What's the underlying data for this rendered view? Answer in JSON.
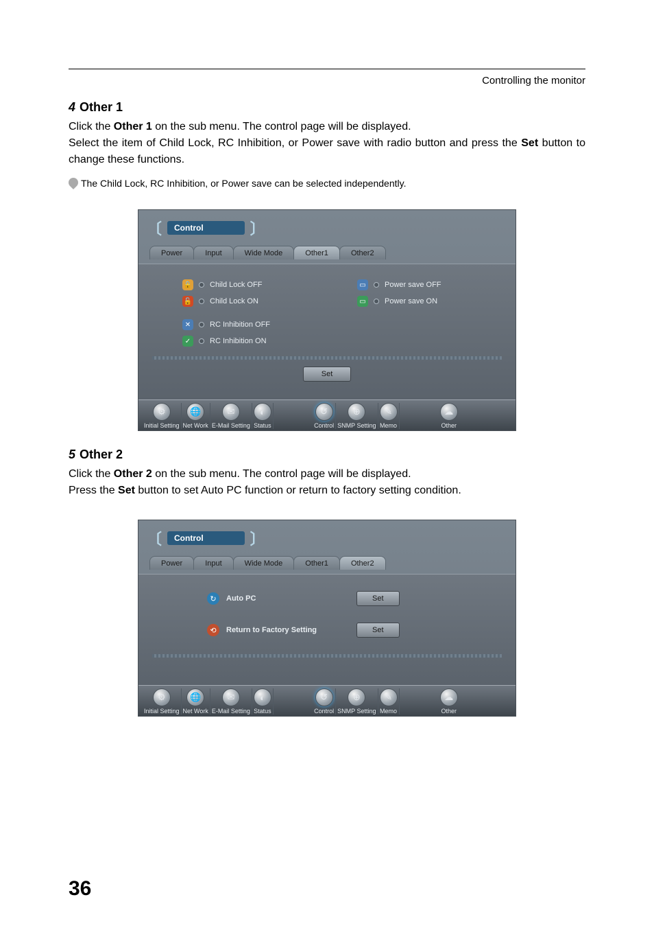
{
  "header": {
    "right": "Controlling the monitor"
  },
  "section1": {
    "num": "4",
    "title": "Other 1",
    "para": "Click the <b>Other 1</b> on the sub menu. The control page will be displayed.\nSelect the item of Child Lock, RC Inhibition, or Power save with radio button and press the <b>Set</b> button to change these functions.",
    "note": "The Child Lock, RC Inhibition, or Power save can be selected independently."
  },
  "panel1": {
    "bracket_title": "Control",
    "tabs": [
      "Power",
      "Input",
      "Wide Mode",
      "Other1",
      "Other2"
    ],
    "active_tab": 3,
    "child_lock_off": "Child Lock OFF",
    "child_lock_on": "Child Lock ON",
    "rc_off": "RC Inhibition OFF",
    "rc_on": "RC Inhibition ON",
    "ps_off": "Power save OFF",
    "ps_on": "Power save ON",
    "set_label": "Set",
    "footer": [
      "Initial Setting",
      "Net Work",
      "E-Mail Setting",
      "Status",
      "Control",
      "SNMP Setting",
      "Memo",
      "Other"
    ],
    "footer_active": 4
  },
  "section2": {
    "num": "5",
    "title": "Other 2",
    "para": "Click the <b>Other 2</b> on the sub menu. The control page will be displayed.\nPress the <b>Set</b> button to set Auto PC function or return to factory setting condition."
  },
  "panel2": {
    "bracket_title": "Control",
    "tabs": [
      "Power",
      "Input",
      "Wide Mode",
      "Other1",
      "Other2"
    ],
    "active_tab": 4,
    "auto_pc": "Auto PC",
    "factory": "Return to Factory Setting",
    "set_label": "Set",
    "footer": [
      "Initial Setting",
      "Net Work",
      "E-Mail Setting",
      "Status",
      "Control",
      "SNMP Setting",
      "Memo",
      "Other"
    ],
    "footer_active": 4
  },
  "page_number": "36"
}
